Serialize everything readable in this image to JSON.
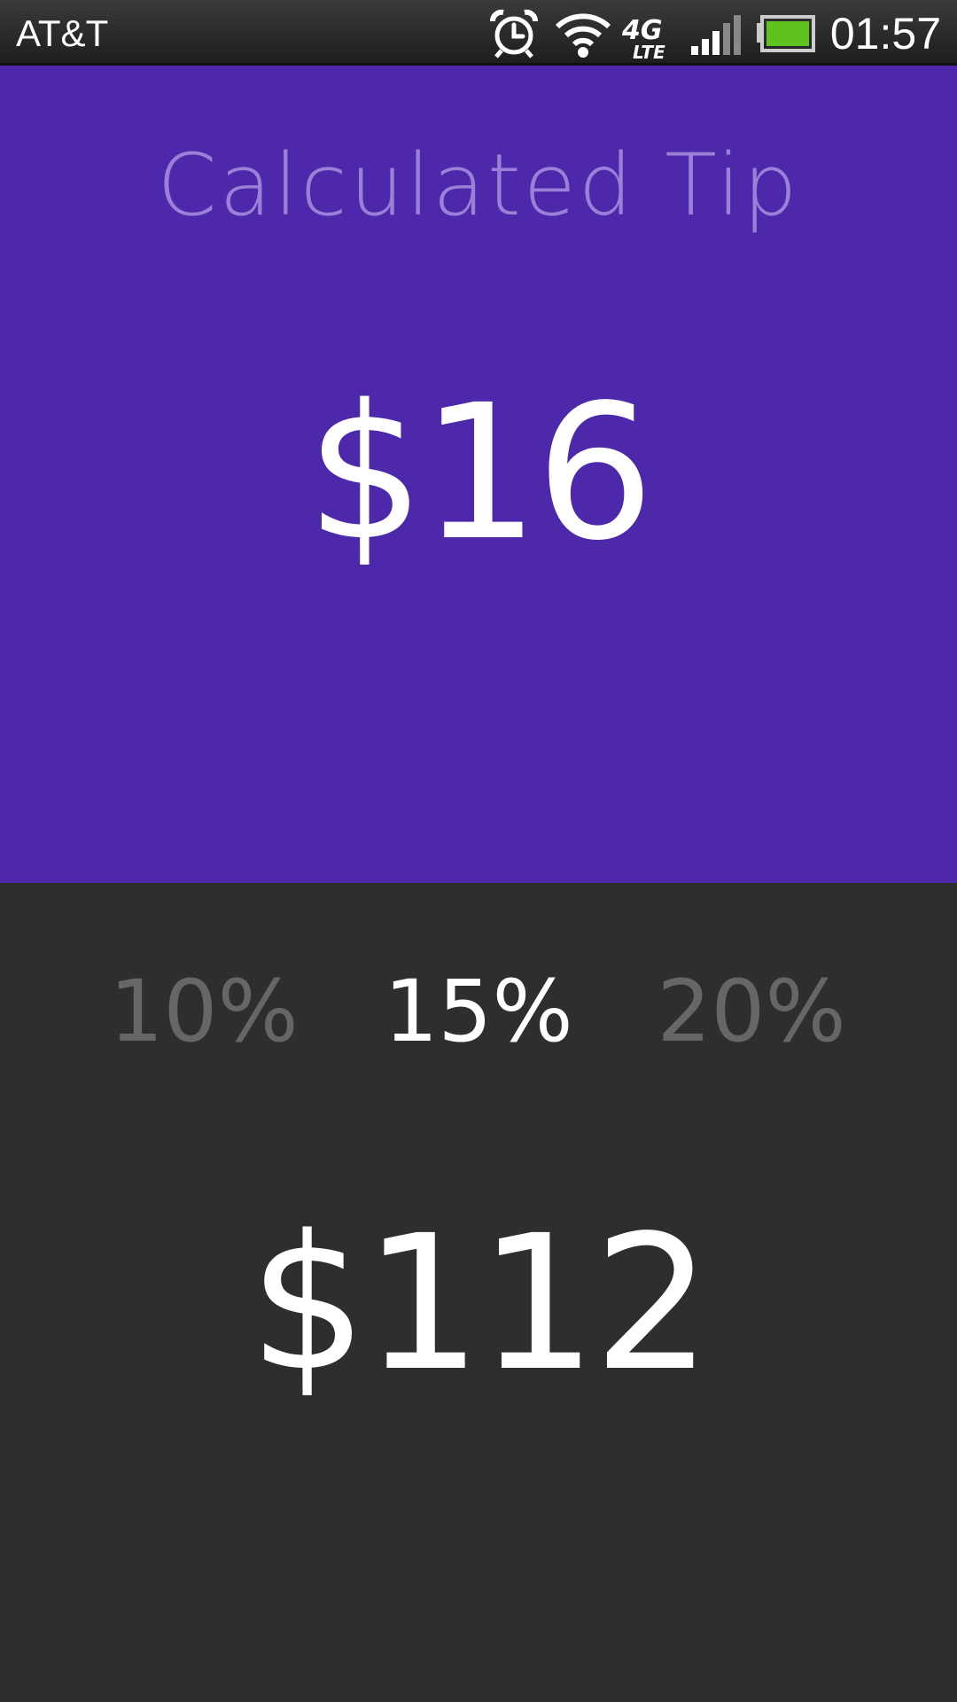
{
  "status_bar": {
    "carrier": "AT&T",
    "time": "01:57",
    "icons": [
      "alarm-icon",
      "wifi-icon",
      "lte-icon",
      "signal-icon",
      "battery-icon"
    ],
    "battery_color": "#5ec21f"
  },
  "tip": {
    "title": "Calculated Tip",
    "amount": "$16"
  },
  "percentages": {
    "options": [
      "10%",
      "15%",
      "20%"
    ],
    "selected": "15%"
  },
  "total": {
    "amount": "$112"
  },
  "colors": {
    "accent": "#4e28aa",
    "title": "#9a80d6",
    "background": "#2e2e2e",
    "inactive": "#666666"
  }
}
